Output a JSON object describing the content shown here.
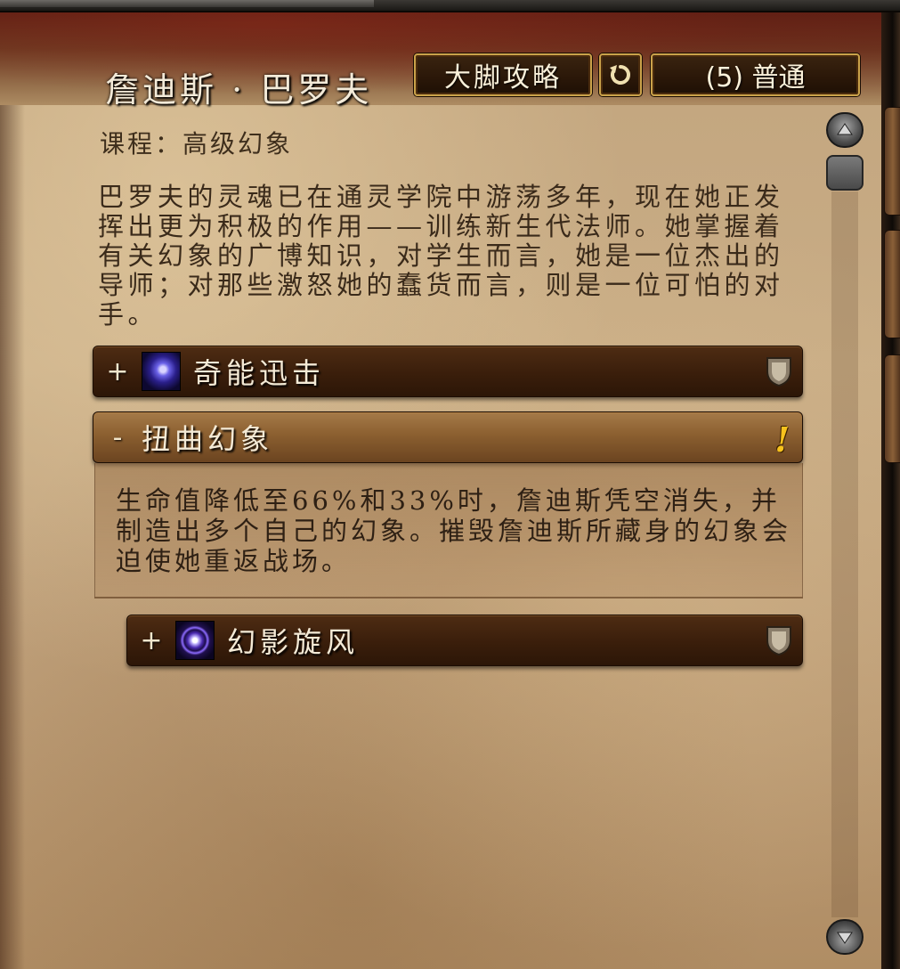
{
  "header": {
    "boss_name": "詹迪斯 · 巴罗夫",
    "guide_button": "大脚攻略",
    "difficulty_button": "(5) 普通"
  },
  "overview": {
    "course": "课程：高级幻象",
    "description": "巴罗夫的灵魂已在通灵学院中游荡多年，现在她正发挥出更为积极的作用——训练新生代法师。她掌握着有关幻象的广博知识，对学生而言，她是一位杰出的导师；对那些激怒她的蠢货而言，则是一位可怕的对手。"
  },
  "sections": [
    {
      "toggle": "+",
      "label": "奇能迅击",
      "icon": "arcane-hand-icon",
      "marker": "tank-shield-icon",
      "expanded": false
    },
    {
      "toggle": "-",
      "label": "扭曲幻象",
      "icon": "",
      "marker": "exclamation-icon",
      "expanded": true,
      "body": "生命值降低至66%和33%时，詹迪斯凭空消失，并制造出多个自己的幻象。摧毁詹迪斯所藏身的幻象会迫使她重返战场。"
    },
    {
      "toggle": "+",
      "label": "幻影旋风",
      "icon": "vortex-icon",
      "marker": "tank-shield-icon",
      "expanded": false
    }
  ],
  "colors": {
    "parchment": "#c4a780",
    "section_bar": "#3a1e0b",
    "section_open": "#8b5f30",
    "button_border": "#caa24a",
    "alert": "#f7c21d"
  }
}
